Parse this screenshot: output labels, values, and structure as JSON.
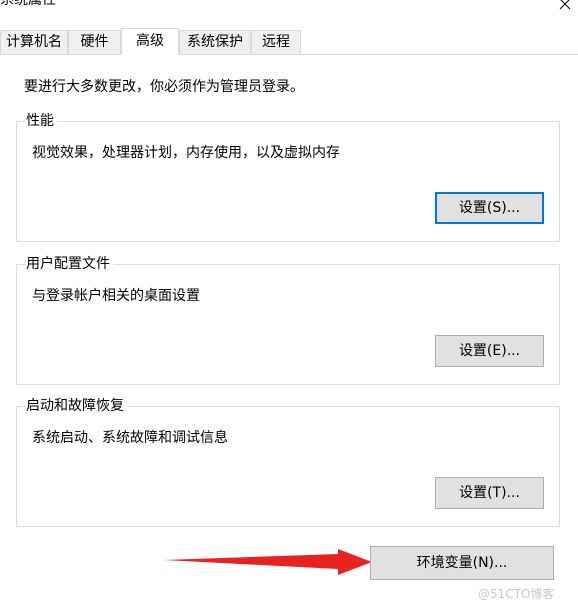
{
  "window": {
    "title": "系统属性"
  },
  "tabs": [
    {
      "label": "计算机名",
      "active": false
    },
    {
      "label": "硬件",
      "active": false
    },
    {
      "label": "高级",
      "active": true
    },
    {
      "label": "系统保护",
      "active": false
    },
    {
      "label": "远程",
      "active": false
    }
  ],
  "notice": "要进行大多数更改，你必须作为管理员登录。",
  "groups": {
    "performance": {
      "title": "性能",
      "description": "视觉效果，处理器计划，内存使用，以及虚拟内存",
      "button": "设置(S)..."
    },
    "user_profiles": {
      "title": "用户配置文件",
      "description": "与登录帐户相关的桌面设置",
      "button": "设置(E)..."
    },
    "startup_recovery": {
      "title": "启动和故障恢复",
      "description": "系统启动、系统故障和调试信息",
      "button": "设置(T)..."
    }
  },
  "env_button": "环境变量(N)...",
  "watermark": "@51CTO博客",
  "colors": {
    "accent": "#0078d7",
    "arrow": "#e8231f",
    "button_bg": "#e1e1e1",
    "tab_bg": "#f0f0f0"
  },
  "icons": {
    "close": "close-icon",
    "arrow": "annotation-arrow-icon"
  }
}
